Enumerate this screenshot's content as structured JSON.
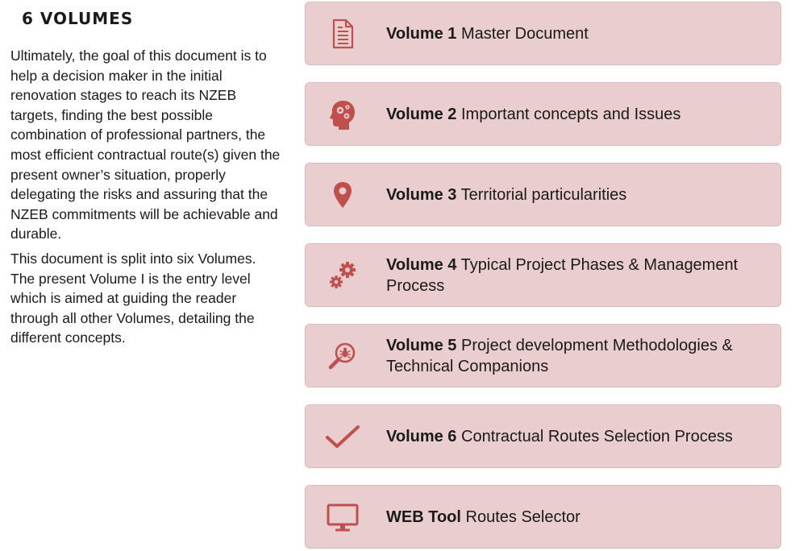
{
  "section": {
    "title": "6 VOLUMES",
    "paragraphs": [
      "Ultimately, the goal of this document is to help a decision maker in the initial renovation stages to reach its NZEB targets, finding the best possible combination of professional partners, the most efficient contractual route(s) given the present owner’s situation, properly delegating the risks and assuring that the NZEB commitments will be achievable and durable.",
      "This document is split into six Volumes. The present Volume I is the entry level which is aimed at guiding the reader through all other Volumes, detailing the different concepts."
    ]
  },
  "volumes": [
    {
      "number_label": "Volume 1",
      "title": "Master Document",
      "icon": "document-icon"
    },
    {
      "number_label": "Volume 2",
      "title": "Important concepts and Issues",
      "icon": "head-gears-icon"
    },
    {
      "number_label": "Volume 3",
      "title": "Territorial particularities",
      "icon": "map-pin-icon"
    },
    {
      "number_label": "Volume 4",
      "title": "Typical Project Phases & Management Process",
      "icon": "gears-icon"
    },
    {
      "number_label": "Volume 5",
      "title": "Project development Methodologies & Technical Companions",
      "icon": "magnifier-bug-icon"
    },
    {
      "number_label": "Volume 6",
      "title": "Contractual Routes Selection Process",
      "icon": "checkmark-icon"
    },
    {
      "number_label": "WEB Tool",
      "title": "Routes Selector",
      "icon": "monitor-icon"
    }
  ],
  "colors": {
    "card_background": "#eacdcf",
    "card_border": "#dfb8bb",
    "icon_accent": "#c0504d",
    "text": "#1a1a1a"
  }
}
